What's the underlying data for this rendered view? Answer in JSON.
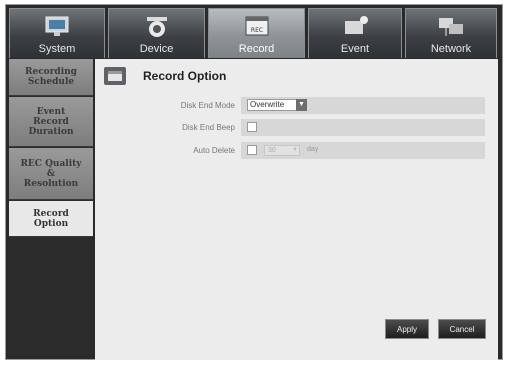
{
  "tabs": [
    {
      "label": "System",
      "icon": "monitor-icon"
    },
    {
      "label": "Device",
      "icon": "camera-icon"
    },
    {
      "label": "Record",
      "icon": "rec-icon"
    },
    {
      "label": "Event",
      "icon": "event-icon"
    },
    {
      "label": "Network",
      "icon": "network-icon"
    }
  ],
  "active_tab": "Record",
  "sidebar": {
    "items": [
      {
        "label": "Recording\nSchedule"
      },
      {
        "label": "Event\nRecord\nDuration"
      },
      {
        "label": "REC Quality\n&\nResolution"
      },
      {
        "label": "Record\nOption"
      }
    ],
    "active": "Record Option"
  },
  "main": {
    "title": "Record Option",
    "disk_end_mode": {
      "label": "Disk End Mode",
      "value": "Overwrite"
    },
    "disk_end_beep": {
      "label": "Disk End Beep",
      "checked": false
    },
    "auto_delete": {
      "label": "Auto Delete",
      "checked": false,
      "value": "30",
      "unit": "day"
    },
    "apply_label": "Apply",
    "cancel_label": "Cancel"
  }
}
